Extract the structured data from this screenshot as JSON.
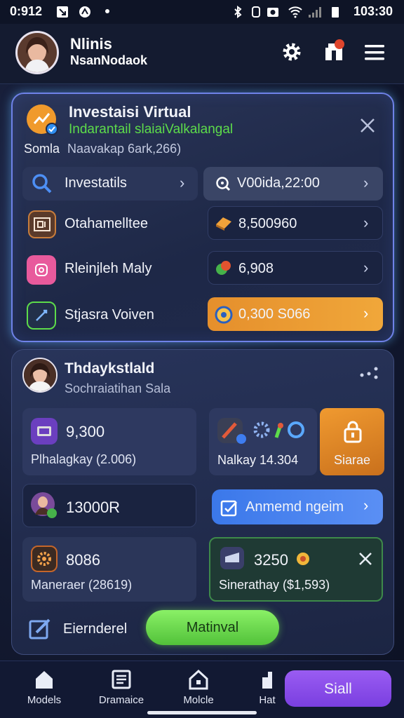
{
  "status_bar": {
    "time_left": "0:912",
    "time_right": "103:30"
  },
  "header": {
    "name": "Nlinis",
    "subname": "NsanNodaok",
    "icons": [
      "gear-icon",
      "notification-bell-icon",
      "menu-icon"
    ]
  },
  "invest_card": {
    "title": "Investaisi Virtual",
    "subtitle": "Indarantail slaiaiValkalangal",
    "meta_label": "Somla",
    "meta_value": "Naavakap 6ark,266)",
    "rows": [
      {
        "left_label": "Investatils",
        "right_value": "V00ida,22:00"
      },
      {
        "left_label": "Otahamelltee",
        "right_value": "8,500960"
      },
      {
        "left_label": "Rleinjleh Maly",
        "right_value": "6,908"
      },
      {
        "left_label": "Stjasra Voiven",
        "right_value": "0,300  S066"
      }
    ],
    "colors": {
      "accent_orange": "#e58f2c",
      "accent_green": "#5ddc4a"
    }
  },
  "profile_card": {
    "title": "Thdaykstlald",
    "subtitle": "Sochraiatihan Sala",
    "stat1_value": "9,300",
    "stat1_label": "Plhalagkay (2.006)",
    "stat2_label": "Nalkay 14.304",
    "stage_button": "Siarae",
    "stat3_value": "13000R",
    "action_button": "Anmemd ngeim",
    "stat4_value": "8086",
    "stat4_label": "Maneraer (28619)",
    "stat5_value": "3250",
    "stat5_label": "Sinerathay ($1,593)",
    "footer_label": "Eiernderel",
    "footer_button": "Matinval",
    "colors": {
      "blue_button": "#3e7df0",
      "green_button": "#6fdc4e",
      "orange_tile": "#e38a2a"
    }
  },
  "bottom_nav": {
    "items": [
      {
        "label": "Models",
        "icon": "home-icon"
      },
      {
        "label": "Dramaice",
        "icon": "news-icon"
      },
      {
        "label": "Molcle",
        "icon": "house-outline-icon"
      },
      {
        "label": "Hat",
        "icon": "hand-icon"
      }
    ],
    "cta": "Siall",
    "cta_color": "#8a4ee8"
  }
}
